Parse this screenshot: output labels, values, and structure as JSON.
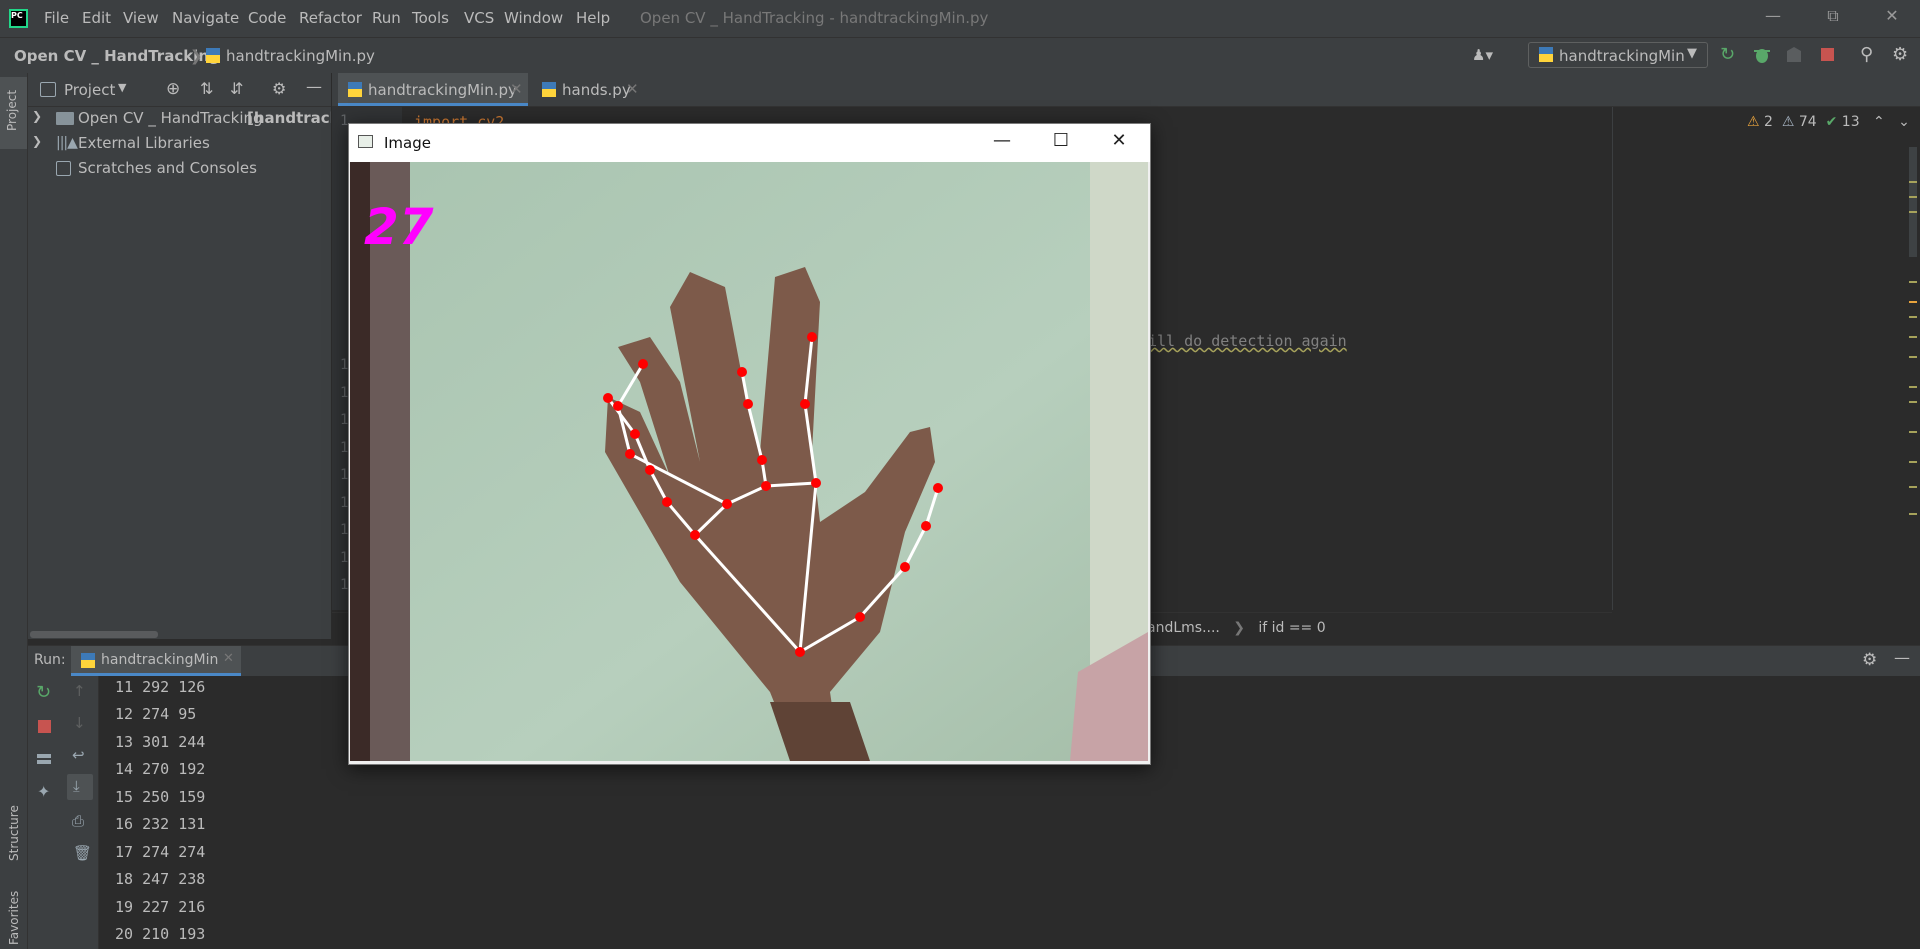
{
  "menu": [
    "File",
    "Edit",
    "View",
    "Navigate",
    "Code",
    "Refactor",
    "Run",
    "Tools",
    "VCS",
    "Window",
    "Help"
  ],
  "window_title": "Open CV _ HandTracking - handtrackingMin.py",
  "breadcrumb": {
    "project": "Open CV _ HandTracking",
    "file": "handtrackingMin.py"
  },
  "run_config": "handtrackingMin",
  "project_panel": {
    "title": "Project",
    "items": [
      {
        "label": "Open CV _ HandTracking",
        "suffix": "[handtracke"
      },
      {
        "label": "External Libraries"
      },
      {
        "label": "Scratches and Consoles"
      }
    ]
  },
  "editor": {
    "tabs": [
      "handtrackingMin.py",
      "hands.py"
    ],
    "visible_code": "import cv2",
    "visible_comment": "ill do detection again",
    "inspections": {
      "warnings": "2",
      "weak_warnings": "74",
      "ok": "13"
    },
    "gutter_numbers": [
      "1",
      "1",
      "1",
      "1",
      "1",
      "1",
      "1",
      "1",
      "1"
    ],
    "breadcrumbs": [
      "andLms....",
      "if id == 0"
    ]
  },
  "left_strip": {
    "project": "Project",
    "structure": "Structure",
    "favorites": "Favorites"
  },
  "run_panel": {
    "label": "Run:",
    "tab": "handtrackingMin",
    "lines": [
      "11 292 126",
      "12 274 95",
      "13 301 244",
      "14 270 192",
      "15 250 159",
      "16 232 131",
      "17 274 274",
      "18 247 238",
      "19 227 216",
      "20 210 193"
    ]
  },
  "image_window": {
    "title": "Image",
    "fps": "27"
  },
  "colors": {
    "accent": "#4a88c7",
    "fps": "#ff00ff",
    "landmark": "#ff0000",
    "connection": "#ffffff"
  }
}
